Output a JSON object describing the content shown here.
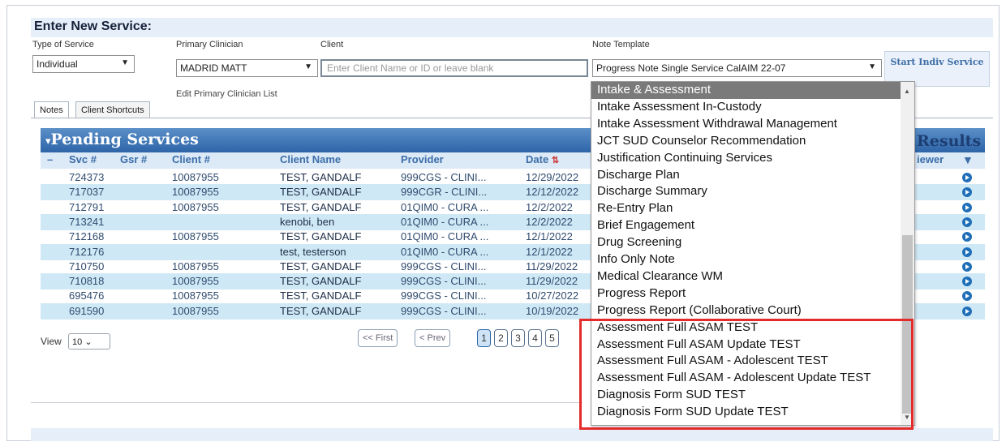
{
  "enter_service": {
    "title": "Enter New Service:",
    "labels": {
      "type_of_service": "Type of Service",
      "primary_clinician": "Primary Clinician",
      "client": "Client",
      "note_template": "Note Template"
    },
    "type_of_service_value": "Individual",
    "primary_clinician_value": "MADRID MATT",
    "client_placeholder": "Enter Client Name or ID or leave blank",
    "note_template_value": "Progress Note Single Service CalAIM 22-07",
    "start_button": "Start Indiv Service",
    "edit_link": "Edit Primary Clinician List"
  },
  "tabs": [
    "Notes",
    "Client Shortcuts"
  ],
  "pending": {
    "title": "Pending Services",
    "results_title": "Results",
    "columns": {
      "svc": "Svc #",
      "gsr": "Gsr #",
      "client": "Client #",
      "name": "Client Name",
      "provider": "Provider",
      "date": "Date",
      "viewer": "iewer"
    },
    "rows": [
      {
        "svc": "724373",
        "client": "10087955",
        "name": "TEST, GANDALF",
        "provider": "999CGS - CLINI...",
        "date": "12/29/2022"
      },
      {
        "svc": "717037",
        "client": "10087955",
        "name": "TEST, GANDALF",
        "provider": "999CGR - CLINI...",
        "date": "12/12/2022"
      },
      {
        "svc": "712791",
        "client": "10087955",
        "name": "TEST, GANDALF",
        "provider": "01QIM0 - CURA ...",
        "date": "12/2/2022"
      },
      {
        "svc": "713241",
        "client": "",
        "name": "kenobi, ben",
        "provider": "01QIM0 - CURA ...",
        "date": "12/2/2022"
      },
      {
        "svc": "712168",
        "client": "10087955",
        "name": "TEST, GANDALF",
        "provider": "01QIM0 - CURA ...",
        "date": "12/1/2022"
      },
      {
        "svc": "712176",
        "client": "",
        "name": "test, testerson",
        "provider": "01QIM0 - CURA ...",
        "date": "12/1/2022"
      },
      {
        "svc": "710750",
        "client": "10087955",
        "name": "TEST, GANDALF",
        "provider": "999CGS - CLINI...",
        "date": "11/29/2022"
      },
      {
        "svc": "710818",
        "client": "10087955",
        "name": "TEST, GANDALF",
        "provider": "999CGS - CLINI...",
        "date": "11/29/2022"
      },
      {
        "svc": "695476",
        "client": "10087955",
        "name": "TEST, GANDALF",
        "provider": "999CGS - CLINI...",
        "date": "10/27/2022"
      },
      {
        "svc": "691590",
        "client": "10087955",
        "name": "TEST, GANDALF",
        "provider": "999CGS - CLINI...",
        "date": "10/19/2022"
      }
    ],
    "view_label": "View",
    "view_value": "10",
    "pager": {
      "first": "<< First",
      "prev": "< Prev",
      "pages": [
        "1",
        "2",
        "3",
        "4",
        "5"
      ],
      "current": "1"
    }
  },
  "template_dropdown": {
    "selected": "Intake & Assessment",
    "items": [
      "Intake & Assessment",
      "Intake Assessment In-Custody",
      "Intake Assessment Withdrawal Management",
      "JCT SUD Counselor Recommendation",
      "Justification Continuing Services",
      "Discharge Plan",
      "Discharge Summary",
      "Re-Entry Plan",
      "Brief Engagement",
      "Drug Screening",
      "Info Only Note",
      "Medical Clearance WM",
      "Progress Report",
      "Progress Report (Collaborative Court)",
      "Assessment Full ASAM TEST",
      "Assessment Full ASAM Update TEST",
      "Assessment Full ASAM - Adolescent TEST",
      "Assessment Full ASAM - Adolescent Update TEST",
      "Diagnosis Form SUD TEST",
      "Diagnosis Form SUD Update TEST"
    ]
  },
  "colors": {
    "header_blue": "#2e65a8",
    "row_alt": "#cfe8f5",
    "highlight_red": "#e32b2b"
  }
}
